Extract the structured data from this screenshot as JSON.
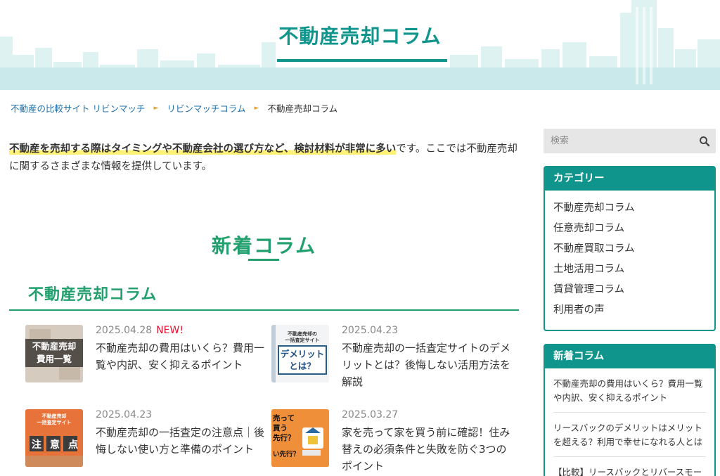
{
  "header": {
    "site_title": "不動産売却コラム"
  },
  "breadcrumb": {
    "items": [
      "不動産の比較サイト リビンマッチ",
      "リビンマッチコラム"
    ],
    "current": "不動産売却コラム",
    "separator": "►"
  },
  "intro": {
    "highlight": "不動産を売却する際はタイミングや不動産会社の選び方など、検討材料が非常に多い",
    "rest": "です。ここでは不動産売却に関するさまざまな情報を提供しています。"
  },
  "main": {
    "section_title": "新着コラム",
    "subsection_title": "不動産売却コラム",
    "articles": [
      {
        "date": "2025.04.28",
        "badge": "NEW!",
        "title": "不動産売却の費用はいくら？費用一覧や内訳、安く抑えるポイント",
        "thumb_lines": [
          "不動産売却",
          "費用一覧"
        ]
      },
      {
        "date": "2025.04.23",
        "title": "不動産売却の一括査定サイトのデメリットとは？後悔しない活用方法を解説",
        "thumb_top": "不動産売却の\n一括査定サイト",
        "thumb_lines": [
          "デメリット",
          "とは？"
        ]
      },
      {
        "date": "2025.04.23",
        "title": "不動産売却の一括査定の注意点｜後悔しない使い方と準備のポイント",
        "thumb_top": "不動産売却\n一括査定サイト",
        "thumb_lines": [
          "注",
          "意",
          "点"
        ]
      },
      {
        "date": "2025.03.27",
        "title": "家を売って家を買う前に確認！住み替えの必須条件と失敗を防ぐ3つのポイント",
        "thumb_lines": [
          "売って",
          "買う",
          "先行？",
          "い先行？"
        ]
      }
    ]
  },
  "sidebar": {
    "search": {
      "placeholder": "検索"
    },
    "category": {
      "title": "カテゴリー",
      "items": [
        "不動産売却コラム",
        "任意売却コラム",
        "不動産買取コラム",
        "土地活用コラム",
        "賃貸管理コラム",
        "利用者の声"
      ]
    },
    "new_columns": {
      "title": "新着コラム",
      "items": [
        "不動産売却の費用はいくら？費用一覧や内訳、安く抑えるポイント",
        "リースバックのデメリットはメリットを超える？利用で幸せになれる人とは",
        "【比較】リースバックとリバースモー"
      ]
    }
  },
  "colors": {
    "accent": "#0f958c",
    "green": "#21a06d",
    "new_badge": "#e5112f",
    "link": "#1f6fa8"
  },
  "icons": {
    "search": "search-icon",
    "breadcrumb_separator": "triangle-right-icon"
  }
}
